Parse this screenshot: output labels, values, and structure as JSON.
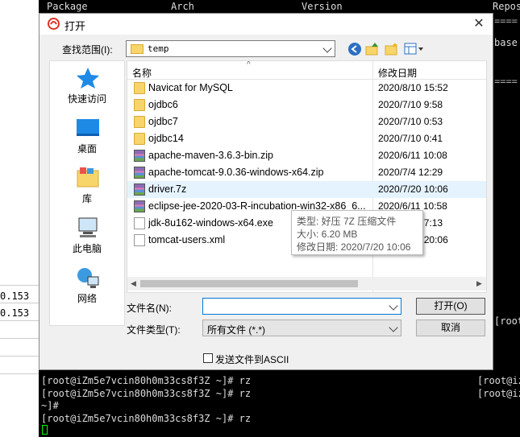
{
  "terminal": {
    "header": {
      "package": "Package",
      "arch": "Arch",
      "version": "Version",
      "repo": "Repos"
    },
    "left_values": [
      "0.153",
      "0.153"
    ],
    "right_texts": [
      "base",
      "====",
      "====",
      "[root@iz",
      "[root@iz",
      "[root@iz"
    ],
    "bottom_lines": [
      "[root@iZm5e7vcin80h0m33cs8f3Z ~]# rz",
      "[root@iZm5e7vcin80h0m33cs8f3Z ~]# rz",
      "~]#",
      "[root@iZm5e7vcin80h0m33cs8f3Z ~]# rz"
    ]
  },
  "dialog": {
    "title": "打开",
    "lookin_label": "查找范围(I):",
    "lookin_value": "temp",
    "places": [
      "快速访问",
      "桌面",
      "库",
      "此电脑",
      "网络"
    ],
    "columns": {
      "name": "名称",
      "date": "修改日期"
    },
    "files": [
      {
        "name": "Navicat for MySQL",
        "date": "2020/8/10 15:52",
        "type": "folder"
      },
      {
        "name": "ojdbc6",
        "date": "2020/7/10 9:58",
        "type": "folder"
      },
      {
        "name": "ojdbc7",
        "date": "2020/7/10 0:53",
        "type": "folder"
      },
      {
        "name": "ojdbc14",
        "date": "2020/7/10 0:41",
        "type": "folder"
      },
      {
        "name": "apache-maven-3.6.3-bin.zip",
        "date": "2020/6/11 10:08",
        "type": "zip"
      },
      {
        "name": "apache-tomcat-9.0.36-windows-x64.zip",
        "date": "2020/7/4 12:29",
        "type": "zip"
      },
      {
        "name": "driver.7z",
        "date": "2020/7/20 10:06",
        "type": "zip"
      },
      {
        "name": "eclipse-jee-2020-03-R-incubation-win32-x86_6...",
        "date": "2020/6/11 10:58",
        "type": "zip"
      },
      {
        "name": "jdk-8u162-windows-x64.exe",
        "date": "2018/3/1 17:13",
        "type": "exe"
      },
      {
        "name": "tomcat-users.xml",
        "date": "2020/7/20 20:06",
        "type": "xml"
      }
    ],
    "tooltip": {
      "type": "类型: 好压 7Z 压缩文件",
      "size": "大小: 6.20 MB",
      "modified": "修改日期: 2020/7/20 10:06"
    },
    "filename_label": "文件名(N):",
    "filename_value": "",
    "filetype_label": "文件类型(T):",
    "filetype_value": "所有文件 (*.*)",
    "open_label": "打开(O)",
    "cancel_label": "取消",
    "ascii_label": "发送文件到ASCII"
  }
}
